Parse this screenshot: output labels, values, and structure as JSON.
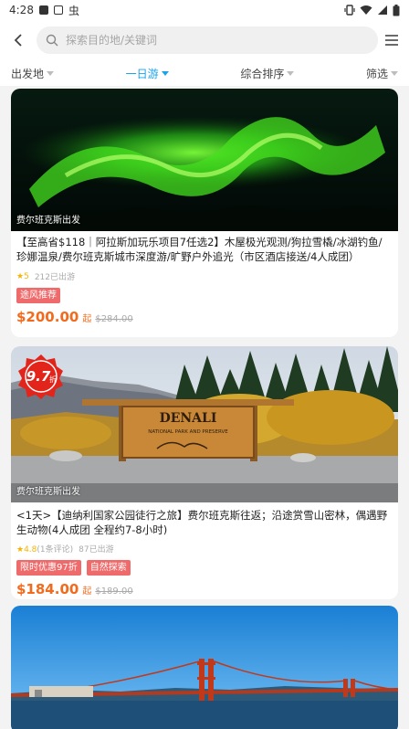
{
  "status": {
    "time": "4:28",
    "bug_label": "虫"
  },
  "search": {
    "placeholder": "探索目的地/关键词"
  },
  "filters": [
    {
      "label": "出发地",
      "active": false
    },
    {
      "label": "一日游",
      "active": true
    },
    {
      "label": "综合排序",
      "active": false
    },
    {
      "label": "筛选",
      "active": false
    }
  ],
  "colors": {
    "accent": "#1aa3e8",
    "price": "#f26b1d",
    "tag": "#ef6b6b",
    "star": "#f5b400"
  },
  "cards": [
    {
      "origin": "费尔班克斯出发",
      "title": "【至高省$118｜阿拉斯加玩乐项目7任选2】木屋极光观测/狗拉雪橇/冰湖钓鱼/珍娜温泉/费尔班克斯城市深度游/旷野户外追光（市区酒店接送/4人成团）",
      "rating": "5",
      "sold": "212已出游",
      "tags": [
        "途风推荐"
      ],
      "price": "$200.00",
      "price_suffix": "起",
      "old_price": "$284.00",
      "image": "aurora"
    },
    {
      "origin": "费尔班克斯出发",
      "title": "<1天>【迪纳利国家公园徒行之旅】费尔班克斯往返；沿途赏雪山密林，偶遇野生动物(4人成团 全程约7-8小时)",
      "rating": "4.8",
      "reviews": "(1条评论)",
      "sold": "87已出游",
      "tags": [
        "限时优惠97折",
        "自然探索"
      ],
      "price": "$184.00",
      "price_suffix": "起",
      "old_price": "$189.00",
      "badge": "9.7",
      "badge_suffix": "折",
      "sign_text": "DENALI",
      "sign_sub": "NATIONAL PARK AND PRESERVE",
      "image": "denali"
    },
    {
      "image": "golden-gate"
    }
  ]
}
